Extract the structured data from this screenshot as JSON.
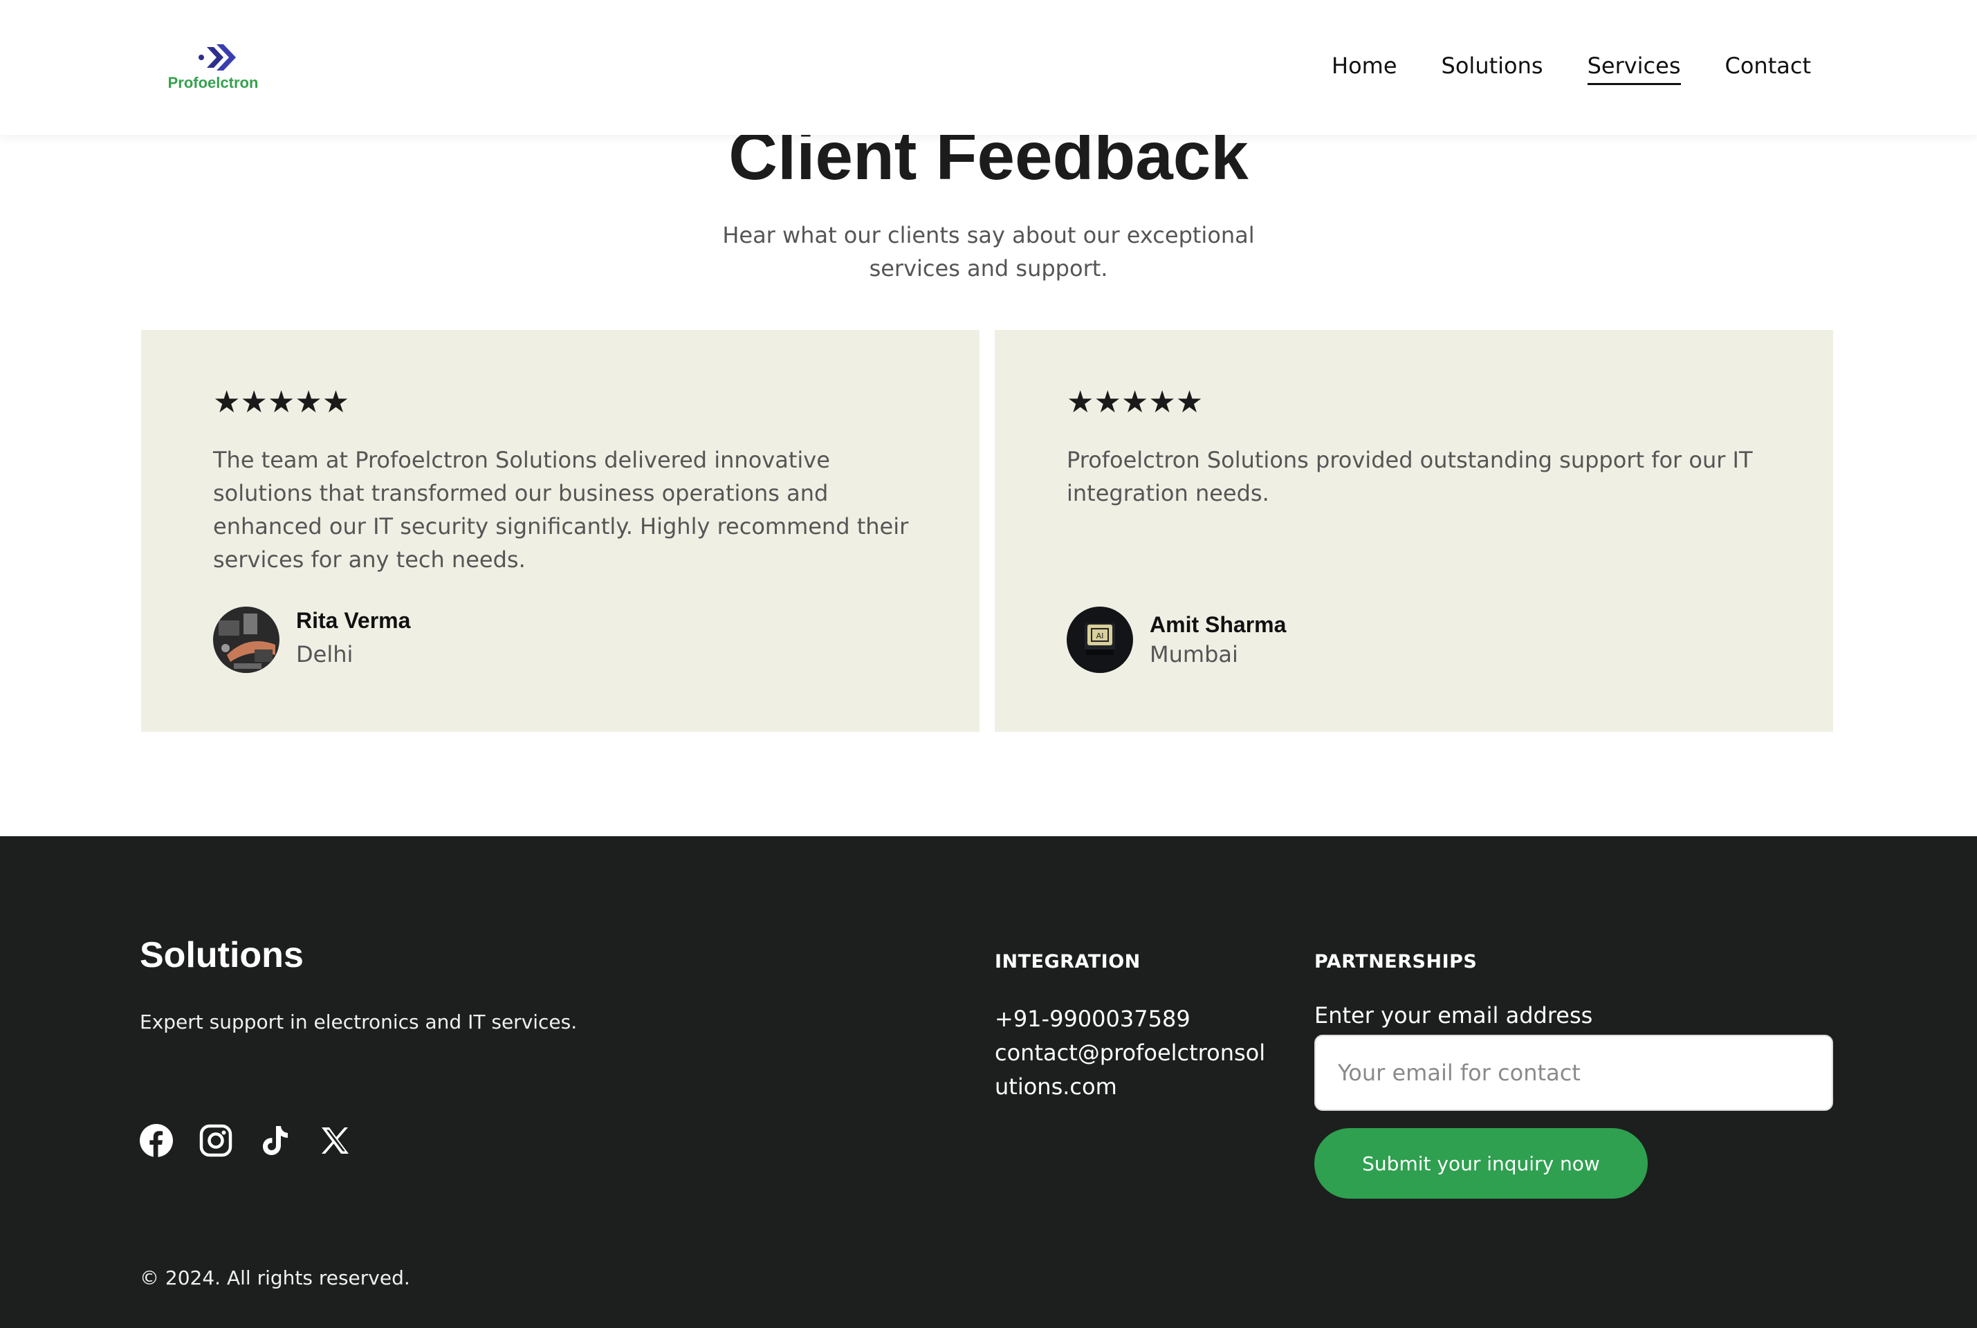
{
  "brand": {
    "name": "Profoelctron",
    "logo_icon": "double-chevron-right-icon"
  },
  "nav": {
    "items": [
      {
        "label": "Home",
        "active": false
      },
      {
        "label": "Solutions",
        "active": false
      },
      {
        "label": "Services",
        "active": true
      },
      {
        "label": "Contact",
        "active": false
      }
    ]
  },
  "feedback": {
    "title": "Client Feedback",
    "subtitle": "Hear what our clients say about our exceptional services and support.",
    "cards": [
      {
        "stars": "★★★★★",
        "rating": 5,
        "quote": "The team at Profoelctron Solutions delivered innovative solutions that transformed our business operations and enhanced our IT security significantly. Highly recommend their services for any tech needs.",
        "name": "Rita Verma",
        "city": "Delhi"
      },
      {
        "stars": "★★★★★",
        "rating": 5,
        "quote": "Profoelctron Solutions provided outstanding support for our IT integration needs.",
        "name": "Amit Sharma",
        "city": "Mumbai",
        "avatar_text": "AI"
      }
    ]
  },
  "footer": {
    "title": "Solutions",
    "description": "Expert support in electronics and IT services.",
    "socials": [
      "facebook-icon",
      "instagram-icon",
      "tiktok-icon",
      "x-icon"
    ],
    "integration": {
      "heading": "INTEGRATION",
      "phone": "+91-9900037589",
      "email": "contact@profoelctronsolutions.com"
    },
    "partnerships": {
      "heading": "PARTNERSHIPS",
      "email_label": "Enter your email address",
      "email_placeholder": "Your email for contact",
      "submit_label": "Submit your inquiry now"
    },
    "copyright": "© 2024. All rights reserved."
  },
  "colors": {
    "accent_green": "#2ea04f",
    "logo_blue": "#2d2f8f",
    "card_bg": "#f0efe4",
    "footer_bg": "#1c1f1d"
  }
}
